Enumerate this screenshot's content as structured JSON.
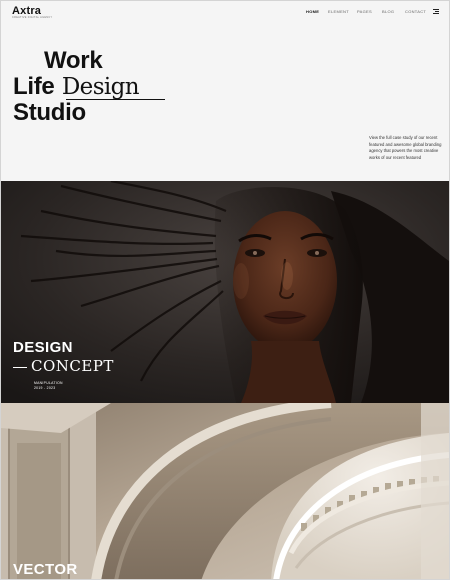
{
  "brand": {
    "logo": "Axtra",
    "tagline": "CREATIVE DIGITAL AGENCY"
  },
  "nav": {
    "items": [
      {
        "label": "HOME",
        "active": true
      },
      {
        "label": "ELEMENT",
        "active": false
      },
      {
        "label": "PAGES",
        "active": false
      },
      {
        "label": "BLOG",
        "active": false
      },
      {
        "label": "CONTACT",
        "active": false
      }
    ],
    "menu_icon": "hamburger-icon"
  },
  "hero": {
    "line1": "Work",
    "line2_bold": "Life",
    "line2_script": "Design",
    "line3": "Studio",
    "blurb": "View the full case study of our recent featured and awesome global branding agency that powers the most creative works of our recent featured"
  },
  "projects": [
    {
      "title": "DESIGN",
      "subtitle": "CONCEPT",
      "category": "MANIPULATION",
      "years": "2019 - 2023"
    },
    {
      "title": "VECTOR"
    }
  ],
  "colors": {
    "background": "#f5f5f5",
    "text": "#111111",
    "overlay_text": "#ffffff"
  }
}
